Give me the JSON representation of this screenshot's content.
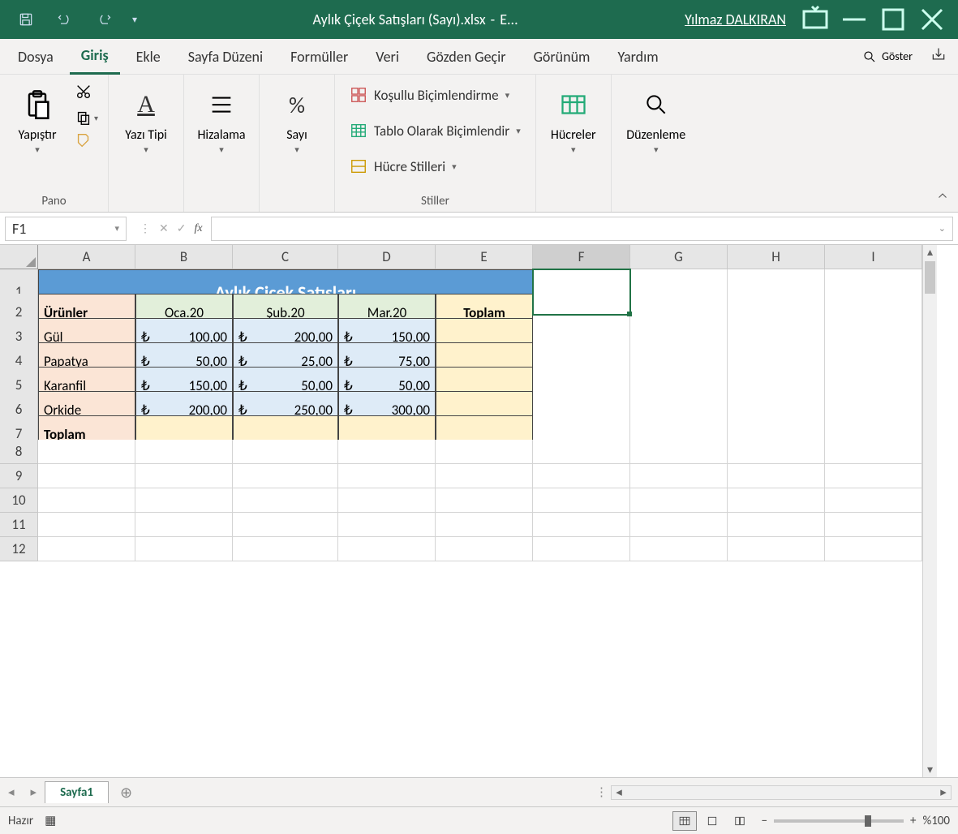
{
  "titlebar": {
    "filename": "Aylık Çiçek Satışları (Sayı).xlsx",
    "separator": "-",
    "app": "E...",
    "user": "Yılmaz DALKIRAN"
  },
  "tabs": {
    "file": "Dosya",
    "home": "Giriş",
    "insert": "Ekle",
    "pageLayout": "Sayfa Düzeni",
    "formulas": "Formüller",
    "data": "Veri",
    "review": "Gözden Geçir",
    "view": "Görünüm",
    "help": "Yardım",
    "search": "Göster"
  },
  "ribbon": {
    "clipboard": {
      "paste": "Yapıştır",
      "group": "Pano"
    },
    "font": {
      "btn": "Yazı Tipi"
    },
    "align": {
      "btn": "Hizalama"
    },
    "number": {
      "btn": "Sayı"
    },
    "styles": {
      "cond": "Koşullu Biçimlendirme",
      "table": "Tablo Olarak Biçimlendir",
      "cell": "Hücre Stilleri",
      "group": "Stiller"
    },
    "cells": {
      "btn": "Hücreler"
    },
    "editing": {
      "btn": "Düzenleme"
    }
  },
  "namebox": "F1",
  "columns": [
    "A",
    "B",
    "C",
    "D",
    "E",
    "F",
    "G",
    "H",
    "I"
  ],
  "rows": [
    "1",
    "2",
    "3",
    "4",
    "5",
    "6",
    "7",
    "8",
    "9",
    "10",
    "11",
    "12"
  ],
  "sheet": {
    "title": "Aylık Çiçek Satışları",
    "headers": {
      "products": "Ürünler",
      "m1": "Oca.20",
      "m2": "Şub.20",
      "m3": "Mar.20",
      "total": "Toplam"
    },
    "data": [
      {
        "name": "Gül",
        "m1": "100,00",
        "m2": "200,00",
        "m3": "150,00"
      },
      {
        "name": "Papatya",
        "m1": "50,00",
        "m2": "25,00",
        "m3": "75,00"
      },
      {
        "name": "Karanfil",
        "m1": "150,00",
        "m2": "50,00",
        "m3": "50,00"
      },
      {
        "name": "Orkide",
        "m1": "200,00",
        "m2": "250,00",
        "m3": "300,00"
      }
    ],
    "totalRow": "Toplam",
    "currency": "₺"
  },
  "sheetTab": "Sayfa1",
  "status": {
    "ready": "Hazır",
    "zoom": "%100"
  }
}
